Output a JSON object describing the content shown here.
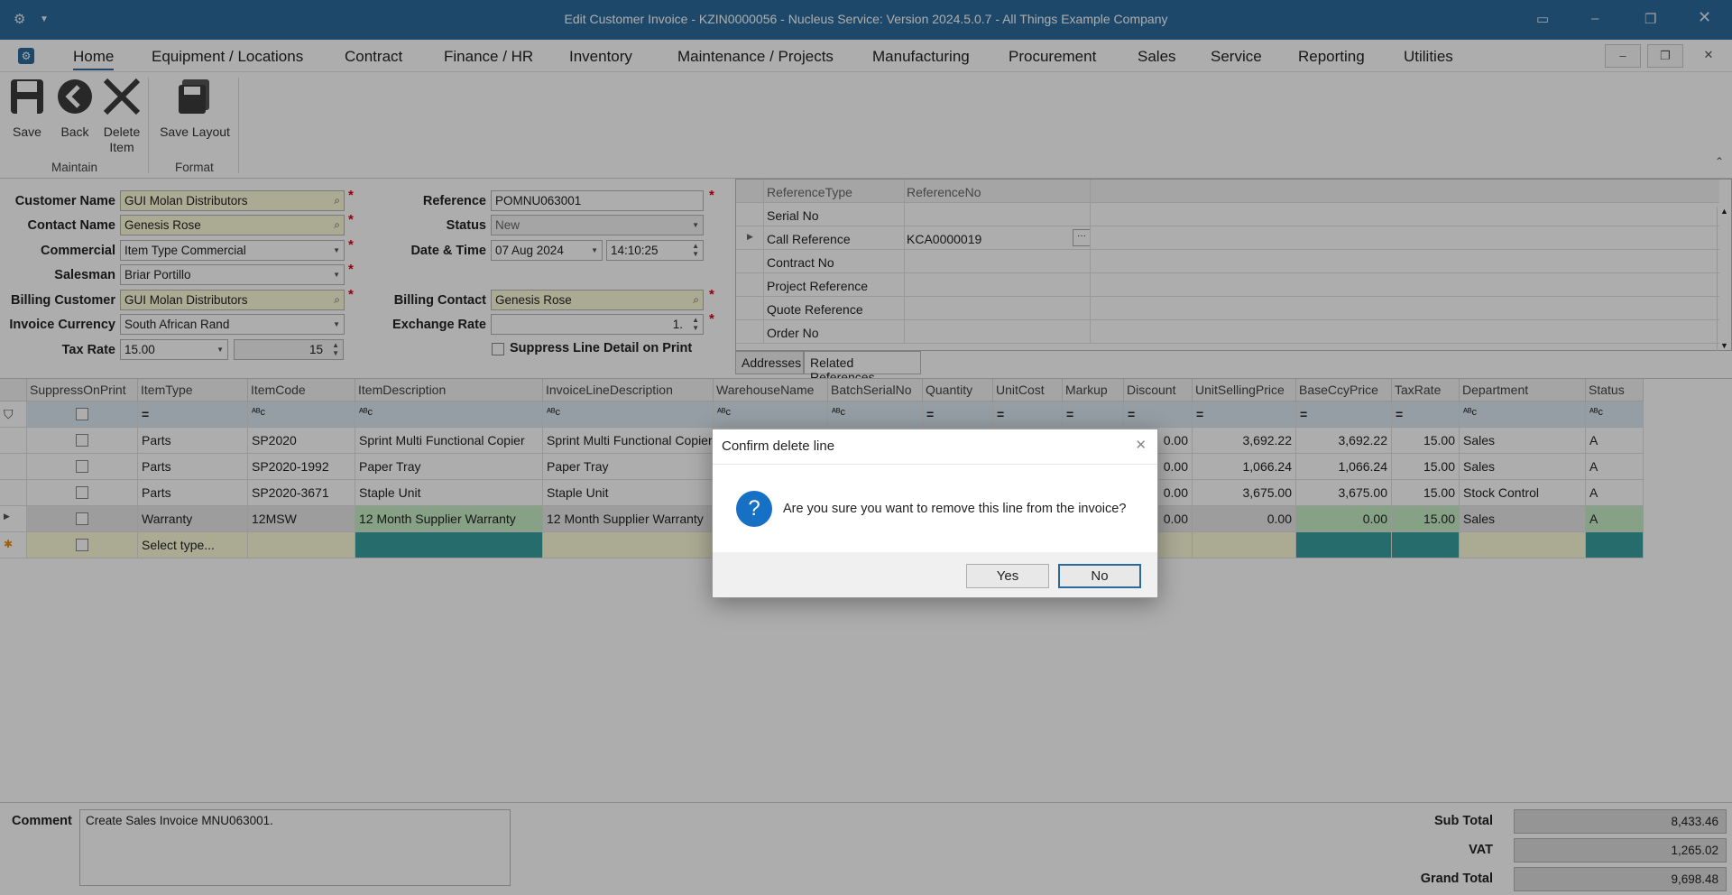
{
  "titlebar": {
    "title": "Edit Customer Invoice - KZIN0000056 - Nucleus Service: Version 2024.5.0.7 - All Things Example Company",
    "accent": "#2b6a9c"
  },
  "menu": [
    "Home",
    "Equipment / Locations",
    "Contract",
    "Finance / HR",
    "Inventory",
    "Maintenance / Projects",
    "Manufacturing",
    "Procurement",
    "Sales",
    "Service",
    "Reporting",
    "Utilities"
  ],
  "ribbon": {
    "save": "Save",
    "back": "Back",
    "delete_l1": "Delete",
    "delete_l2": "Item",
    "save_layout": "Save Layout",
    "group_maintain": "Maintain",
    "group_format": "Format"
  },
  "form": {
    "customer_name_label": "Customer Name",
    "customer_name": "GUI Molan Distributors",
    "contact_name_label": "Contact Name",
    "contact_name": "Genesis Rose",
    "commercial_label": "Commercial",
    "commercial": "Item Type Commercial",
    "salesman_label": "Salesman",
    "salesman": "Briar Portillo",
    "billing_customer_label": "Billing Customer",
    "billing_customer": "GUI Molan Distributors",
    "invoice_currency_label": "Invoice Currency",
    "invoice_currency": "South African Rand",
    "tax_rate_label": "Tax Rate",
    "tax_rate": "15.00",
    "tax_rate_2": "15",
    "reference_label": "Reference",
    "reference": "POMNU063001",
    "status_label": "Status",
    "status": "New",
    "datetime_label": "Date & Time",
    "date": "07 Aug 2024",
    "time": "14:10:25",
    "billing_contact_label": "Billing Contact",
    "billing_contact": "Genesis Rose",
    "exchange_rate_label": "Exchange Rate",
    "exchange_rate": "1.",
    "suppress_label": "Suppress Line Detail on Print"
  },
  "refgrid": {
    "headers": [
      "ReferenceType",
      "ReferenceNo"
    ],
    "rows": [
      {
        "type": "Serial No",
        "no": ""
      },
      {
        "type": "Call Reference",
        "no": "KCA0000019"
      },
      {
        "type": "Contract No",
        "no": ""
      },
      {
        "type": "Project Reference",
        "no": ""
      },
      {
        "type": "Quote Reference",
        "no": ""
      },
      {
        "type": "Order No",
        "no": ""
      }
    ]
  },
  "tabs": [
    "Addresses",
    "Related References"
  ],
  "grid": {
    "headers": [
      "SuppressOnPrint",
      "ItemType",
      "ItemCode",
      "ItemDescription",
      "InvoiceLineDescription",
      "WarehouseName",
      "BatchSerialNo",
      "Quantity",
      "UnitCost",
      "Markup",
      "Discount",
      "UnitSellingPrice",
      "BaseCcyPrice",
      "TaxRate",
      "Department",
      "Status"
    ],
    "rows": [
      {
        "type": "Parts",
        "code": "SP2020",
        "desc": "Sprint Multi Functional Copier",
        "ldesc": "Sprint Multi Functional Copier",
        "disc": "0.00",
        "usp": "3,692.22",
        "base": "3,692.22",
        "tax": "15.00",
        "dept": "Sales",
        "status": "A"
      },
      {
        "type": "Parts",
        "code": "SP2020-1992",
        "desc": "Paper Tray",
        "ldesc": "Paper Tray",
        "disc": "0.00",
        "usp": "1,066.24",
        "base": "1,066.24",
        "tax": "15.00",
        "dept": "Sales",
        "status": "A"
      },
      {
        "type": "Parts",
        "code": "SP2020-3671",
        "desc": "Staple Unit",
        "ldesc": "Staple Unit",
        "disc": "0.00",
        "usp": "3,675.00",
        "base": "3,675.00",
        "tax": "15.00",
        "dept": "Stock Control",
        "status": "A"
      },
      {
        "type": "Warranty",
        "code": "12MSW",
        "desc": "12 Month Supplier Warranty",
        "ldesc": "12 Month Supplier Warranty",
        "disc": "0.00",
        "usp": "0.00",
        "base": "0.00",
        "tax": "15.00",
        "dept": "Sales",
        "status": "A"
      }
    ],
    "new_row_placeholder": "Select type..."
  },
  "bottom": {
    "comment_label": "Comment",
    "comment": "Create Sales Invoice MNU063001.",
    "subtotal_label": "Sub Total",
    "subtotal": "8,433.46",
    "vat_label": "VAT",
    "vat": "1,265.02",
    "grand_label": "Grand Total",
    "grand": "9,698.48"
  },
  "dialog": {
    "title": "Confirm delete line",
    "message": "Are you sure you want to remove this line from the invoice?",
    "yes": "Yes",
    "no": "No",
    "icon": "question-icon"
  }
}
